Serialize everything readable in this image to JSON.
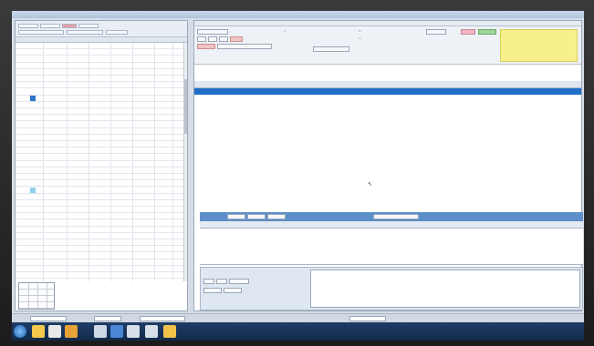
{
  "window": {
    "title": ""
  },
  "left_panel": {
    "tabs": [
      {
        "label": "",
        "selected": false
      },
      {
        "label": "",
        "selected": false
      },
      {
        "label": "",
        "selected": true
      },
      {
        "label": "",
        "selected": false
      },
      {
        "label": "",
        "selected": false
      }
    ],
    "headers": [
      "",
      "",
      "",
      "",
      "",
      ""
    ],
    "rows": [
      {
        "date": "",
        "slot": ""
      },
      {
        "date": "",
        "slot": ""
      },
      {
        "date": "",
        "slot": ""
      },
      {
        "date": "",
        "slot": ""
      },
      {
        "date": "",
        "slot": ""
      }
    ],
    "mini_table": {
      "rows": [
        "",
        "",
        "",
        ""
      ]
    }
  },
  "right_panel": {
    "tabs": [
      "",
      "",
      "",
      ""
    ],
    "toolbar": {
      "buttons": [
        "",
        "",
        "",
        "",
        "",
        ""
      ],
      "action_buttons": [
        "",
        ""
      ]
    },
    "table": {
      "headers": [
        "",
        "",
        "",
        "",
        "",
        "",
        "",
        "",
        "",
        "",
        "",
        ""
      ],
      "rows": [
        {
          "cells": [
            "",
            "",
            "",
            "",
            "",
            "",
            "",
            "",
            ""
          ],
          "selected": true
        },
        {
          "cells": [
            "",
            "",
            "",
            "",
            "",
            "",
            "",
            "",
            ""
          ],
          "selected": false
        }
      ]
    },
    "section2": {
      "title": "",
      "tool_buttons": [
        "",
        "",
        "",
        ""
      ],
      "headers": [
        "",
        "",
        "",
        "",
        "",
        "",
        "",
        "",
        "",
        "",
        ""
      ]
    },
    "section3": {
      "title": "",
      "buttons": [
        "",
        "",
        "",
        "",
        ""
      ]
    }
  },
  "status_bar": {
    "fields": [
      "",
      "",
      "",
      ""
    ]
  },
  "taskbar": {
    "icons": [
      "explorer-icon",
      "media-icon",
      "browser-icon",
      "app-icon",
      "app-icon",
      "app-icon",
      "folder-icon"
    ],
    "tray_text": ""
  },
  "colors": {
    "selected_row": "#1f6fc7",
    "section_bar": "#5c8fc9",
    "note_yellow": "#f8f08a",
    "green_button": "#9fd79a",
    "pink_button": "#f0b6c2"
  }
}
